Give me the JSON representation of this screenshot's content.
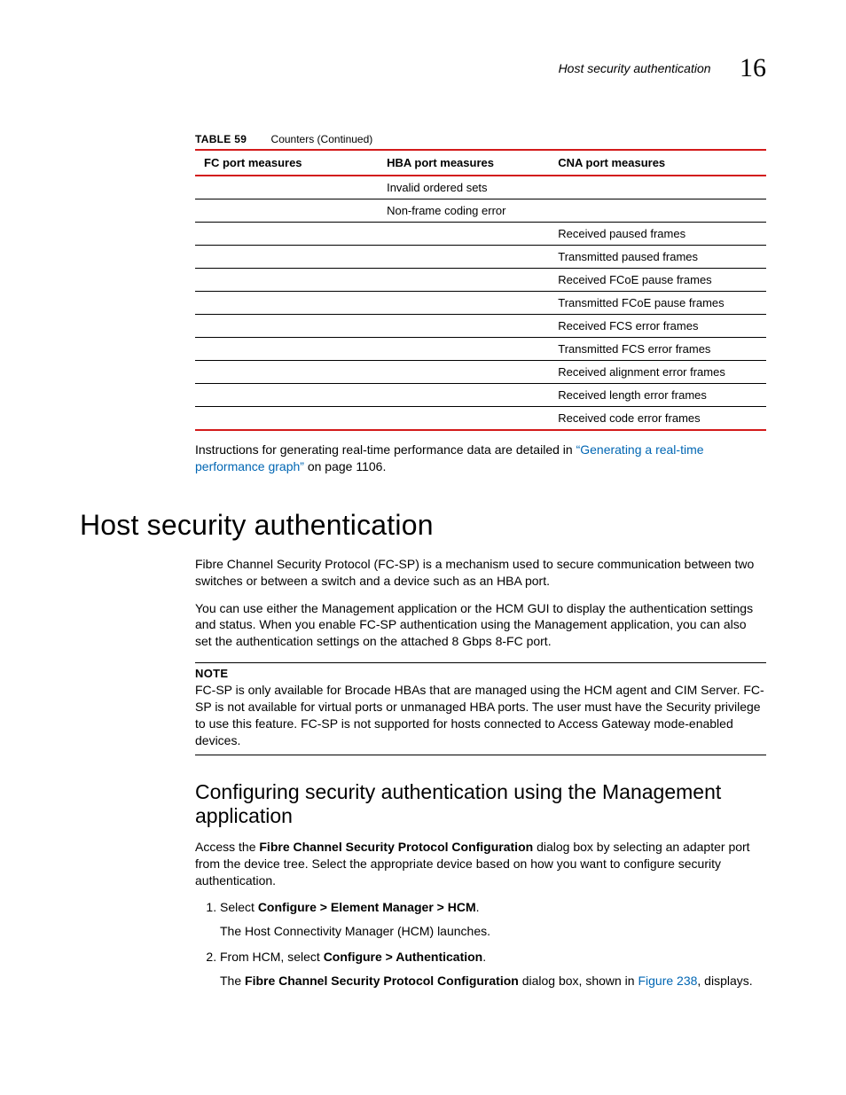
{
  "header": {
    "running_title": "Host security authentication",
    "chapter_number": "16"
  },
  "table": {
    "caption_label": "TABLE 59",
    "caption_title": "Counters (Continued)",
    "columns": [
      "FC port measures",
      "HBA port measures",
      "CNA port measures"
    ],
    "rows": [
      [
        "",
        "Invalid ordered sets",
        ""
      ],
      [
        "",
        "Non-frame coding error",
        ""
      ],
      [
        "",
        "",
        "Received paused frames"
      ],
      [
        "",
        "",
        "Transmitted paused frames"
      ],
      [
        "",
        "",
        "Received FCoE pause frames"
      ],
      [
        "",
        "",
        "Transmitted FCoE pause frames"
      ],
      [
        "",
        "",
        "Received FCS error frames"
      ],
      [
        "",
        "",
        "Transmitted FCS error frames"
      ],
      [
        "",
        "",
        "Received alignment error frames"
      ],
      [
        "",
        "",
        "Received length error frames"
      ],
      [
        "",
        "",
        "Received code error frames"
      ]
    ]
  },
  "post_table": {
    "lead": "Instructions for generating real-time performance data are detailed in ",
    "link_text": "“Generating a real-time performance graph”",
    "trail": " on page 1106."
  },
  "section": {
    "title": "Host security authentication",
    "p1": "Fibre Channel Security Protocol (FC-SP) is a mechanism used to secure communication between two switches or between a switch and a device such as an HBA port.",
    "p2": "You can use either the Management application or the HCM GUI to display the authentication settings and status. When you enable FC-SP authentication using the Management application, you can also set the authentication settings on the attached 8 Gbps 8-FC port."
  },
  "note": {
    "label": "NOTE",
    "body": "FC-SP is only available for Brocade HBAs that are managed using the HCM agent and CIM Server. FC-SP is not available for virtual ports or unmanaged HBA ports. The user must have the Security privilege to use this feature. FC-SP is not supported for hosts connected to Access Gateway mode-enabled devices."
  },
  "subsection": {
    "title": "Configuring security authentication using the Management application",
    "intro_pre": "Access the ",
    "intro_bold": "Fibre Channel Security Protocol Configuration",
    "intro_post": " dialog box by selecting an adapter port from the device tree. Select the appropriate device based on how you want to configure security authentication.",
    "steps": [
      {
        "pre": "Select ",
        "bold": "Configure > Element Manager > HCM",
        "post": ".",
        "sub": "The Host Connectivity Manager (HCM) launches."
      },
      {
        "pre": "From HCM, select ",
        "bold": "Configure > Authentication",
        "post": ".",
        "sub_pre": "The ",
        "sub_bold": "Fibre Channel Security Protocol Configuration",
        "sub_mid": " dialog box, shown in ",
        "sub_link": "Figure 238",
        "sub_post": ", displays."
      }
    ]
  }
}
